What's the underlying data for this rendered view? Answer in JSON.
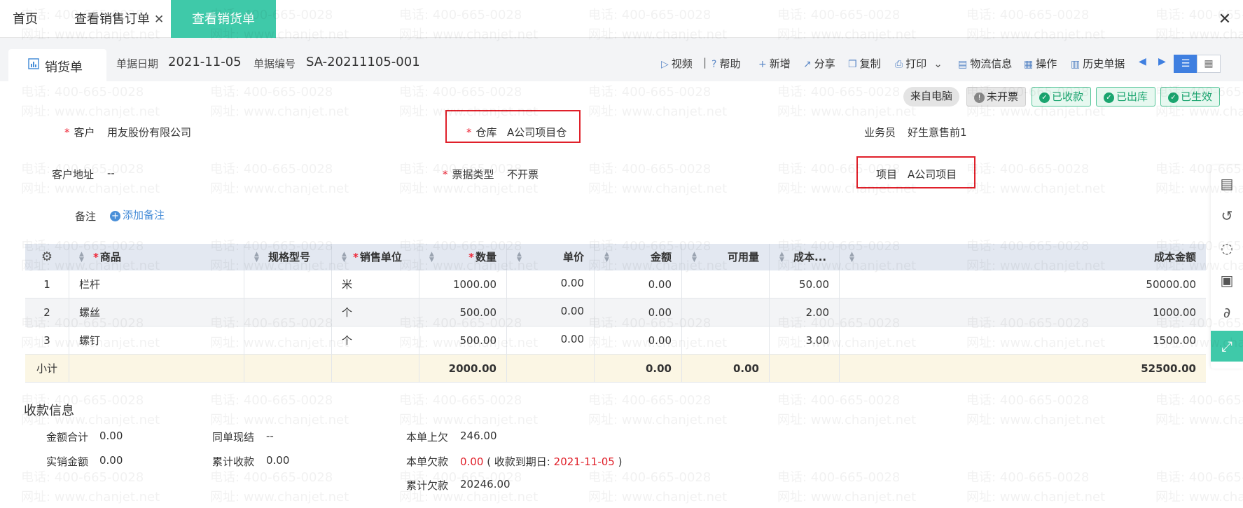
{
  "top_tabs": [
    {
      "label": "首页",
      "closable": false,
      "active": false
    },
    {
      "label": "查看销售订单",
      "closable": true,
      "active": false
    },
    {
      "label": "查看销货单",
      "closable": true,
      "active": true
    }
  ],
  "window_close": "✕",
  "doc": {
    "tab_label": "销货单",
    "date_label": "单据日期",
    "date_value": "2021-11-05",
    "number_label": "单据编号",
    "number_value": "SA-20211105-001"
  },
  "toolbar": {
    "video": "视频",
    "divider": "|",
    "help": "帮助",
    "add": "新增",
    "share": "分享",
    "copy": "复制",
    "print": "打印",
    "logistics": "物流信息",
    "operate": "操作",
    "history": "历史单据"
  },
  "status_chips": {
    "from_pc": "来自电脑",
    "not_invoiced": "未开票",
    "paid": "已收款",
    "shipped": "已出库",
    "effective": "已生效"
  },
  "form": {
    "customer_label": "客户",
    "customer_value": "用友股份有限公司",
    "warehouse_label": "仓库",
    "warehouse_value": "A公司项目仓",
    "salesman_label": "业务员",
    "salesman_value": "好生意售前1",
    "address_label": "客户地址",
    "address_value": "--",
    "invoice_type_label": "票据类型",
    "invoice_type_value": "不开票",
    "project_label": "项目",
    "project_value": "A公司项目",
    "note_label": "备注",
    "add_note": "添加备注"
  },
  "table": {
    "headers": {
      "product": "商品",
      "spec": "规格型号",
      "unit": "销售单位",
      "qty": "数量",
      "price": "单价",
      "amount": "金额",
      "available": "可用量",
      "cost": "成本...",
      "cost_amount": "成本金额"
    },
    "rows": [
      {
        "no": "1",
        "product": "栏杆",
        "spec": "",
        "unit": "米",
        "qty": "1000.00",
        "price": "0.00",
        "amount": "0.00",
        "available": "",
        "cost": "50.00",
        "cost_amount": "50000.00"
      },
      {
        "no": "2",
        "product": "螺丝",
        "spec": "",
        "unit": "个",
        "qty": "500.00",
        "price": "0.00",
        "amount": "0.00",
        "available": "",
        "cost": "2.00",
        "cost_amount": "1000.00"
      },
      {
        "no": "3",
        "product": "螺钉",
        "spec": "",
        "unit": "个",
        "qty": "500.00",
        "price": "0.00",
        "amount": "0.00",
        "available": "",
        "cost": "3.00",
        "cost_amount": "1500.00"
      }
    ],
    "subtotal": {
      "label": "小计",
      "qty": "2000.00",
      "amount": "0.00",
      "available": "0.00",
      "cost_amount": "52500.00"
    }
  },
  "payment": {
    "title": "收款信息",
    "total_label": "金额合计",
    "total_value": "0.00",
    "settle_label": "同单现结",
    "settle_value": "--",
    "owed_prev_label": "本单上欠",
    "owed_prev_value": "246.00",
    "actual_label": "实销金额",
    "actual_value": "0.00",
    "cum_received_label": "累计收款",
    "cum_received_value": "0.00",
    "owed_label": "本单欠款",
    "owed_value": "0.00",
    "due_prefix": "( 收款到期日:",
    "due_date": "2021-11-05",
    "due_suffix": ")",
    "cum_owed_label": "累计欠款",
    "cum_owed_value": "20246.00"
  },
  "watermark": {
    "phone": "电话: 400-665-0028",
    "site": "网址: www.chanjet.net"
  },
  "colors": {
    "accent_green": "#3fc9a9",
    "required_red": "#e0202a",
    "link_blue": "#4a8fd8",
    "header_row": "#e3e8f1",
    "subtotal_row": "#fbf6e4"
  },
  "side_tools": [
    "document-edit-icon",
    "history-icon",
    "debt-icon",
    "voucher-icon",
    "attachment-icon",
    "expand-icon"
  ]
}
